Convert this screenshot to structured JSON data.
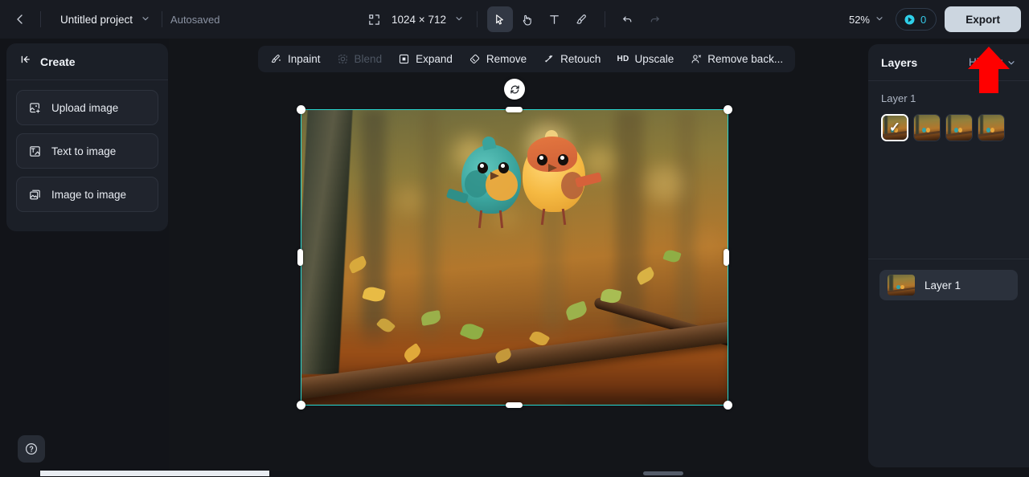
{
  "topbar": {
    "back_icon": "chevron-left-icon",
    "project_name": "Untitled project",
    "project_dropdown_icon": "chevron-down-icon",
    "autosaved_label": "Autosaved",
    "canvas_size_icon": "crop-frame-icon",
    "canvas_size": "1024 × 712",
    "canvas_size_dropdown_icon": "chevron-down-icon",
    "tools": [
      {
        "name": "select-tool",
        "icon": "cursor-arrow-icon",
        "active": true
      },
      {
        "name": "hand-tool",
        "icon": "hand-icon",
        "active": false
      },
      {
        "name": "text-tool",
        "icon": "text-t-icon",
        "active": false
      },
      {
        "name": "brush-tool",
        "icon": "brush-icon",
        "active": false
      },
      {
        "name": "undo-tool",
        "icon": "undo-arrow-icon",
        "active": false
      },
      {
        "name": "redo-tool",
        "icon": "redo-arrow-icon",
        "active": false,
        "disabled": true
      }
    ],
    "zoom_level": "52%",
    "zoom_dropdown_icon": "chevron-down-icon",
    "credits_icon": "credit-token-icon",
    "credits_count": "0",
    "export_label": "Export"
  },
  "left_panel": {
    "collapse_icon": "collapse-panel-icon",
    "title": "Create",
    "items": [
      {
        "label": "Upload image",
        "icon": "image-plus-icon"
      },
      {
        "label": "Text to image",
        "icon": "text-image-icon"
      },
      {
        "label": "Image to image",
        "icon": "image-stack-icon"
      }
    ]
  },
  "canvas_toolbar": {
    "items": [
      {
        "label": "Inpaint",
        "icon": "inpaint-wand-icon",
        "disabled": false
      },
      {
        "label": "Blend",
        "icon": "blend-icon",
        "disabled": true
      },
      {
        "label": "Expand",
        "icon": "expand-frame-icon",
        "disabled": false
      },
      {
        "label": "Remove",
        "icon": "eraser-icon",
        "disabled": false
      },
      {
        "label": "Retouch",
        "icon": "retouch-wand-icon",
        "disabled": false
      },
      {
        "label": "Upscale",
        "icon": "hd-icon",
        "disabled": false
      },
      {
        "label": "Remove back...",
        "icon": "remove-background-icon",
        "disabled": false
      }
    ]
  },
  "canvas": {
    "rotate_icon": "rotate-icon",
    "selection_color": "#28d6d0",
    "artboard_alt": "two cartoon birds perched on a branch in an autumn forest"
  },
  "right_panel": {
    "title": "Layers",
    "history_tab": "History",
    "history_tab_dropdown_icon": "chevron-down-icon",
    "variants_label": "Layer 1",
    "variants": [
      {
        "name": "variant-thumbnail-1",
        "selected": true,
        "check_icon": "check-icon"
      },
      {
        "name": "variant-thumbnail-2",
        "selected": false
      },
      {
        "name": "variant-thumbnail-3",
        "selected": false
      },
      {
        "name": "variant-thumbnail-4",
        "selected": false
      }
    ],
    "layers": [
      {
        "name": "Layer 1"
      }
    ]
  },
  "footer": {
    "help_icon": "question-circle-icon"
  },
  "annotation": {
    "arrow_color": "#ff0000",
    "arrow_icon": "up-arrow-annotation"
  }
}
